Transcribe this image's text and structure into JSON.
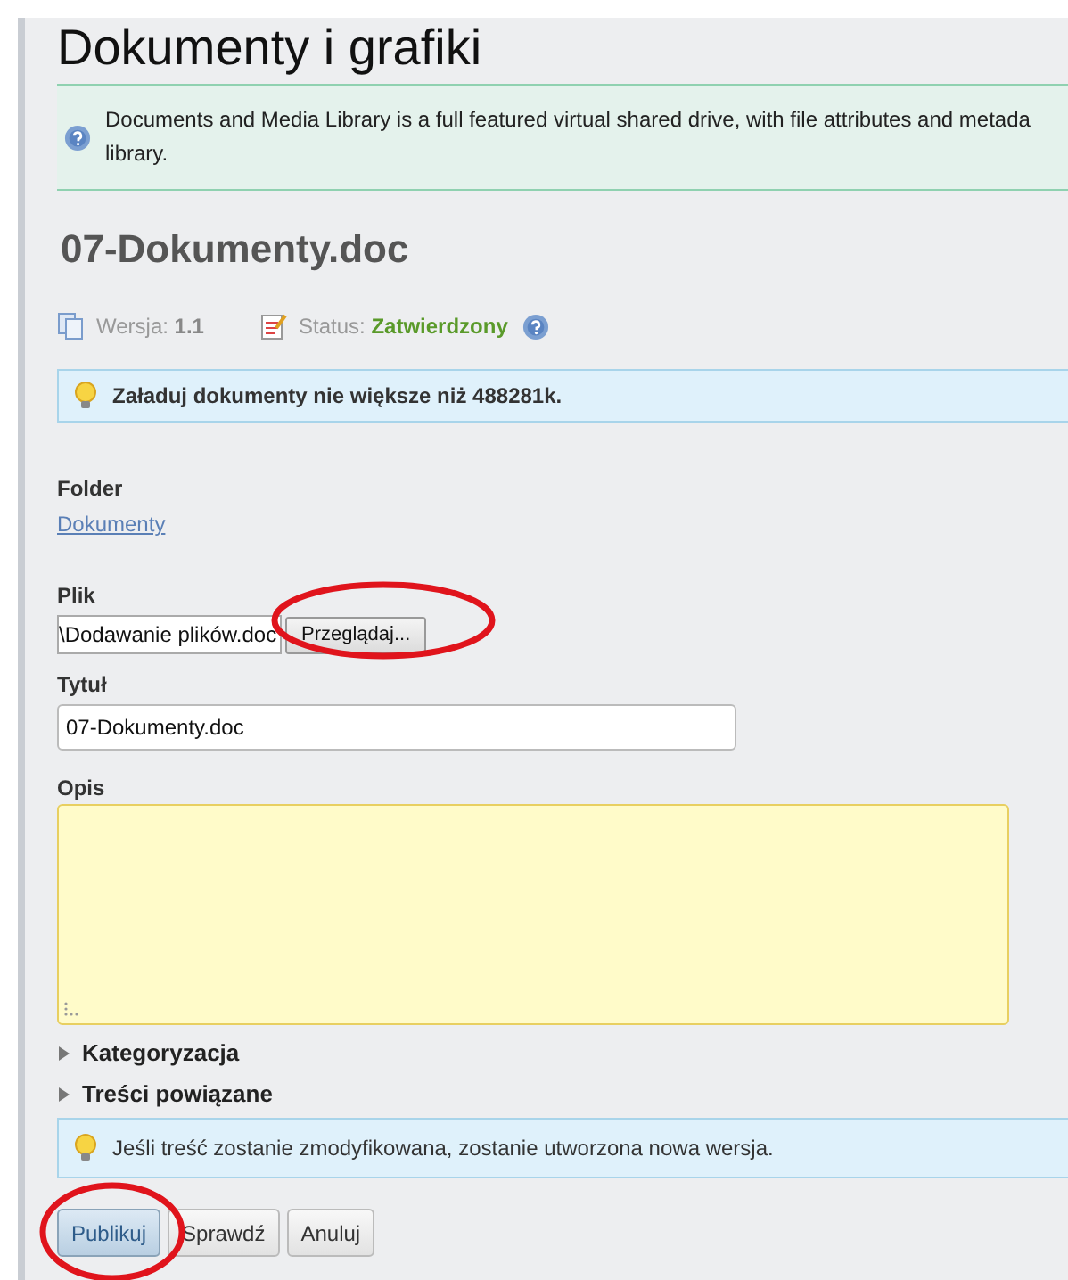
{
  "page_title": "Dokumenty i grafiki",
  "info_box": {
    "lines": [
      "Documents and Media Library is a full featured virtual shared drive, with file attributes and metada",
      "library."
    ]
  },
  "document": {
    "title": "07-Dokumenty.doc",
    "version_label": "Wersja:",
    "version": "1.1",
    "status_label": "Status:",
    "status": "Zatwierdzony"
  },
  "upload_notice": "Załaduj dokumenty nie większe niż 488281k.",
  "folder": {
    "label": "Folder",
    "link": "Dokumenty"
  },
  "file": {
    "label": "Plik",
    "value": "\\Dodawanie plików.doc",
    "browse_button": "Przeglądaj..."
  },
  "title_field": {
    "label": "Tytuł",
    "value": "07-Dokumenty.doc"
  },
  "description_field": {
    "label": "Opis"
  },
  "sections": [
    {
      "label": "Kategoryzacja",
      "expanded": false
    },
    {
      "label": "Treści powiązane",
      "expanded": false
    }
  ],
  "version_notice": "Jeśli treść zostanie zmodyfikowana, zostanie utworzona nowa wersja.",
  "buttons": [
    {
      "label": "Publikuj",
      "kind": "primary"
    },
    {
      "label": "Sprawdź",
      "kind": "secondary"
    },
    {
      "label": "Anuluj",
      "kind": "secondary"
    }
  ]
}
